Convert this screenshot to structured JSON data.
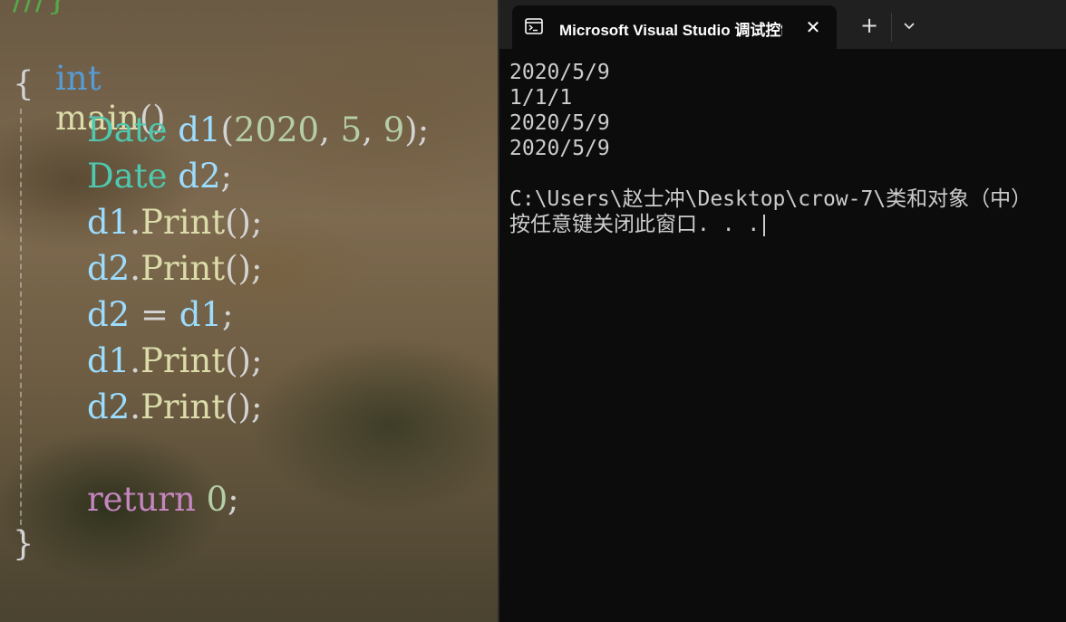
{
  "editor": {
    "top_comment": "///}",
    "line_main": {
      "kw": "int",
      "name": "main",
      "parens": "()"
    },
    "open_brace": "{",
    "stmt1": {
      "type": "Date",
      "var": "d1",
      "open": "(",
      "a": "2020",
      "c1": ", ",
      "b": "5",
      "c2": ", ",
      "c": "9",
      "close": ");"
    },
    "stmt2": {
      "type": "Date",
      "var": "d2",
      "end": ";"
    },
    "stmt3": {
      "obj": "d1",
      "dot": ".",
      "fn": "Print",
      "call": "();"
    },
    "stmt4": {
      "obj": "d2",
      "dot": ".",
      "fn": "Print",
      "call": "();"
    },
    "stmt5": {
      "lhs": "d2",
      "op": " = ",
      "rhs": "d1",
      "end": ";"
    },
    "stmt6": {
      "obj": "d1",
      "dot": ".",
      "fn": "Print",
      "call": "();"
    },
    "stmt7": {
      "obj": "d2",
      "dot": ".",
      "fn": "Print",
      "call": "();"
    },
    "stmt8": {
      "kw": "return",
      "val": "0",
      "end": ";"
    },
    "close_brace": "}"
  },
  "terminal": {
    "tab_title": "Microsoft Visual Studio 调试控制台",
    "output_lines": [
      "2020/5/9",
      "1/1/1",
      "2020/5/9",
      "2020/5/9",
      ""
    ],
    "path_line": "C:\\Users\\赵士冲\\Desktop\\crow-7\\类和对象（中）",
    "prompt_line": "按任意键关闭此窗口. . ."
  },
  "icons": {
    "tab": "terminal-icon",
    "close": "close-icon",
    "new_tab": "plus-icon",
    "dropdown": "chevron-down-icon"
  }
}
